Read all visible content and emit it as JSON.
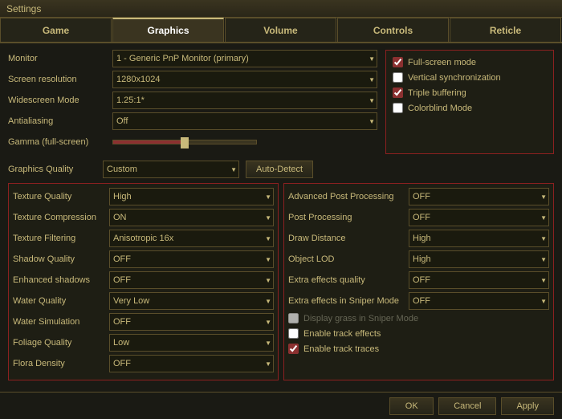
{
  "titleBar": {
    "text": "Settings"
  },
  "tabs": [
    {
      "id": "game",
      "label": "Game",
      "active": false
    },
    {
      "id": "graphics",
      "label": "Graphics",
      "active": true
    },
    {
      "id": "volume",
      "label": "Volume",
      "active": false
    },
    {
      "id": "controls",
      "label": "Controls",
      "active": false
    },
    {
      "id": "reticle",
      "label": "Reticle",
      "active": false
    }
  ],
  "leftSettings": {
    "monitor": {
      "label": "Monitor",
      "value": "1 - Generic PnP Monitor (primary)"
    },
    "screenResolution": {
      "label": "Screen resolution",
      "value": "1280x1024"
    },
    "widescreenMode": {
      "label": "Widescreen Mode",
      "value": "1.25:1*"
    },
    "antialiasing": {
      "label": "Antialiasing",
      "value": "Off"
    },
    "gamma": {
      "label": "Gamma (full-screen)",
      "sliderValue": 50
    }
  },
  "rightCheckboxes": {
    "fullScreen": {
      "label": "Full-screen mode",
      "checked": true
    },
    "verticalSync": {
      "label": "Vertical synchronization",
      "checked": false
    },
    "tripleBuffering": {
      "label": "Triple buffering",
      "checked": true
    },
    "colorblindMode": {
      "label": "Colorblind Mode",
      "checked": false
    }
  },
  "graphicsQuality": {
    "label": "Graphics Quality",
    "value": "Custom",
    "autoDetectLabel": "Auto-Detect"
  },
  "leftQuality": [
    {
      "label": "Texture Quality",
      "value": "High"
    },
    {
      "label": "Texture Compression",
      "value": "ON"
    },
    {
      "label": "Texture Filtering",
      "value": "Anisotropic 16x"
    },
    {
      "label": "Shadow Quality",
      "value": "OFF"
    },
    {
      "label": "Enhanced shadows",
      "value": "OFF"
    },
    {
      "label": "Water Quality",
      "value": "Very Low"
    },
    {
      "label": "Water Simulation",
      "value": "OFF"
    },
    {
      "label": "Foliage Quality",
      "value": "Low"
    },
    {
      "label": "Flora Density",
      "value": "OFF"
    }
  ],
  "rightQuality": [
    {
      "label": "Advanced Post Processing",
      "value": "OFF"
    },
    {
      "label": "Post Processing",
      "value": "OFF"
    },
    {
      "label": "Draw Distance",
      "value": "High"
    },
    {
      "label": "Object LOD",
      "value": "High"
    },
    {
      "label": "Extra effects quality",
      "value": "OFF"
    },
    {
      "label": "Extra effects in Sniper Mode",
      "value": "OFF"
    }
  ],
  "rightCheckboxesBottom": [
    {
      "label": "Display grass in Sniper Mode",
      "checked": false,
      "disabled": true
    },
    {
      "label": "Enable track effects",
      "checked": false,
      "disabled": false
    },
    {
      "label": "Enable track traces",
      "checked": true,
      "disabled": false
    }
  ],
  "bottomButtons": {
    "ok": "OK",
    "cancel": "Cancel",
    "apply": "Apply"
  }
}
